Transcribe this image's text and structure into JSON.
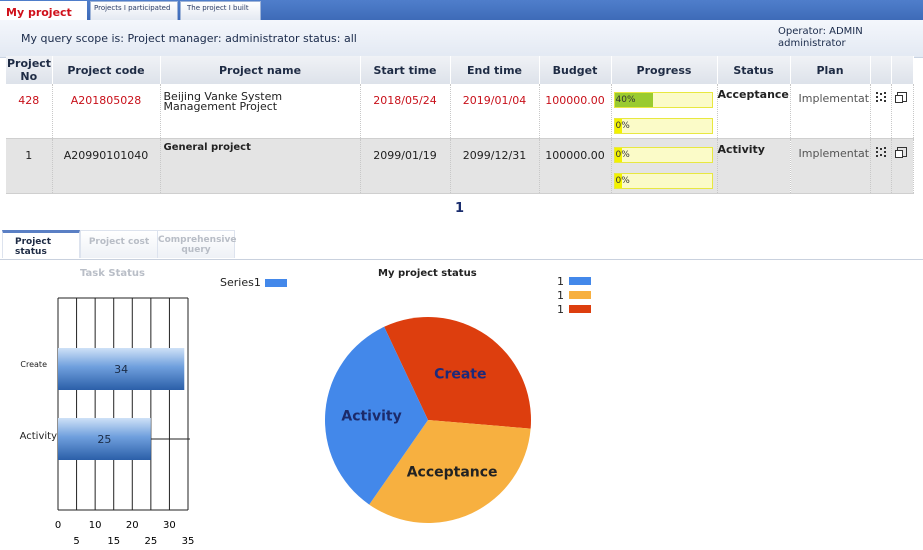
{
  "top_tabs": [
    {
      "label": "My project",
      "active": true
    },
    {
      "label": "Projects I participated",
      "active": false
    },
    {
      "label": "The project I built",
      "active": false
    }
  ],
  "scope_text": "My query scope is: Project manager: administrator status: all",
  "operator": {
    "line1": "Operator: ADMIN",
    "line2": "administrator"
  },
  "table": {
    "headers": [
      "Project No",
      "Project code",
      "Project name",
      "Start time",
      "End time",
      "Budget",
      "Progress",
      "Status",
      "Plan"
    ],
    "rows": [
      {
        "no": "428",
        "code": "A201805028",
        "name": "Beijing Vanke System Management Project",
        "start": "2018/05/24",
        "end": "2019/01/04",
        "budget": "100000.00",
        "progress1": "40%",
        "progress1_value": 40,
        "progress2": "0%",
        "progress2_value": 0,
        "status": "Acceptance",
        "plan": "Implementation Plan"
      },
      {
        "no": "1",
        "code": "A20990101040",
        "name": "General project",
        "start": "2099/01/19",
        "end": "2099/12/31",
        "budget": "100000.00",
        "progress1": "0%",
        "progress1_value": 0,
        "progress2": "0%",
        "progress2_value": 0,
        "status": "Activity",
        "plan": "Implementation Plan"
      }
    ]
  },
  "pager": "1",
  "bottom_tabs": [
    {
      "label": "Project status",
      "active": true
    },
    {
      "label": "Project cost",
      "active": false
    },
    {
      "label": "Comprehensive query",
      "active": false
    }
  ],
  "chart_data": [
    {
      "type": "bar",
      "orientation": "horizontal",
      "title": "Task Status",
      "categories": [
        "Create",
        "Activity"
      ],
      "values": [
        34,
        25
      ],
      "series_legend": "Series1",
      "xlim": [
        0,
        35
      ],
      "xticks_top": [
        0,
        10,
        20,
        30
      ],
      "xticks_bottom": [
        5,
        15,
        25,
        35
      ],
      "colors": {
        "bar": "#3f7fd6"
      }
    },
    {
      "type": "pie",
      "title": "My project status",
      "slices": [
        {
          "label": "Create",
          "value": 1,
          "color": "#dd3e0e"
        },
        {
          "label": "Acceptance",
          "value": 1,
          "color": "#f7b040"
        },
        {
          "label": "Activity",
          "value": 1,
          "color": "#4388ea"
        }
      ],
      "legend": [
        {
          "label": "1",
          "color": "#4388ea"
        },
        {
          "label": "1",
          "color": "#f7b040"
        },
        {
          "label": "1",
          "color": "#dd3e0e"
        }
      ]
    }
  ],
  "colors": {
    "accent": "#d0101a",
    "progress_fill": "#9acb2f",
    "progress_zero": "#f2f200",
    "progress_bg": "#fbfbc8"
  }
}
